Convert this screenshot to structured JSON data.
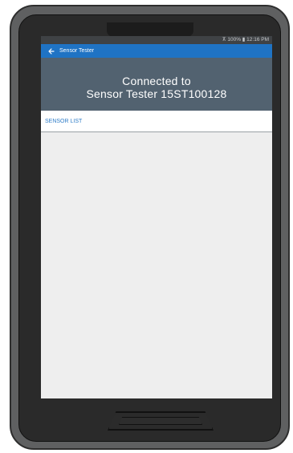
{
  "status_bar": {
    "text": "⊼ 100% ▮ 12:16 PM"
  },
  "app_bar": {
    "back_icon": "back-arrow-icon",
    "title": "Sensor Tester"
  },
  "connection": {
    "line1": "Connected to",
    "line2": "Sensor Tester 15ST100128"
  },
  "tabs": {
    "sensor_list": "SENSOR LIST"
  },
  "colors": {
    "app_bar": "#1f73c4",
    "header": "#526270",
    "tab_text": "#2f7dc8"
  }
}
